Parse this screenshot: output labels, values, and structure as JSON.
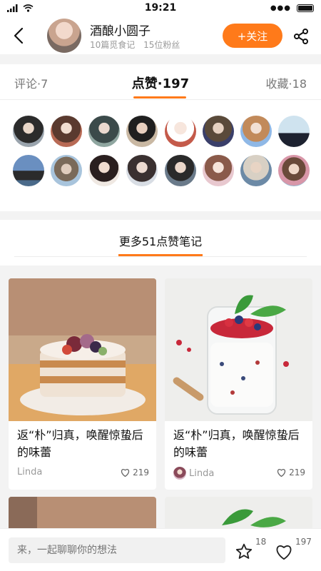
{
  "status_bar": {
    "time": "19:21"
  },
  "header": {
    "user_name": "酒酿小圆子",
    "stats_notes": "10篇觅食记",
    "stats_fans": "15位粉丝",
    "follow_label": "+关注"
  },
  "tabs": {
    "comment": "评论·7",
    "like": "点赞·197",
    "fav": "收藏·18"
  },
  "likers": [
    "liker-1",
    "liker-2",
    "liker-3",
    "liker-4",
    "liker-5",
    "liker-6",
    "liker-7",
    "liker-8",
    "liker-9",
    "liker-10",
    "liker-11",
    "liker-12",
    "liker-13",
    "liker-14",
    "liker-15",
    "liker-16"
  ],
  "more": {
    "title": "更多51点赞笔记"
  },
  "cards": [
    {
      "title": "返“朴”归真，唤醒惊蛰后的味蕾",
      "user": "Linda",
      "likes": "219"
    },
    {
      "title": "返“朴”归真，唤醒惊蛰后的味蕾",
      "user": "Linda",
      "likes": "219"
    }
  ],
  "bottom_bar": {
    "placeholder": "来，一起聊聊你的想法",
    "star_count": "18",
    "heart_count": "197"
  },
  "colors": {
    "accent": "#ff7a1a",
    "page_bg": "#f3f3f3"
  }
}
